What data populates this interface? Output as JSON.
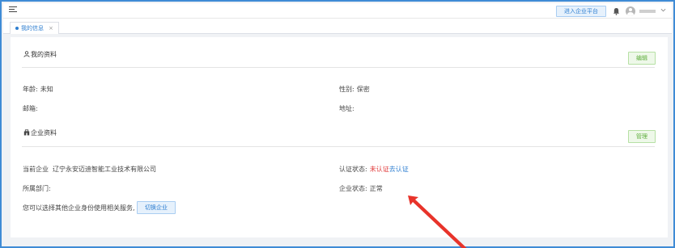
{
  "topbar": {
    "enter_enterprise_label": "进入企业平台",
    "icons": {
      "menu": "menu-toggle-icon",
      "bell": "bell-icon",
      "avatar": "user-avatar-icon",
      "chevron": "chevron-down-icon"
    }
  },
  "tabs": [
    {
      "label": "我的信息",
      "close": "×",
      "active": true
    }
  ],
  "profile": {
    "title": "我的资料",
    "edit_label": "编辑",
    "age_label": "年龄:",
    "age_value": "未知",
    "gender_label": "性别:",
    "gender_value": "保密",
    "email_label": "邮箱:",
    "email_value": "",
    "address_label": "地址:",
    "address_value": ""
  },
  "enterprise": {
    "title": "企业资料",
    "manage_label": "管理",
    "current_label": "当前企业",
    "current_value": "辽宁永安迈迪智能工业技术有限公司",
    "cert_label": "认证状态:",
    "cert_value": "未认证",
    "cert_link": "去认证",
    "dept_label": "所属部门:",
    "dept_value": "",
    "status_label": "企业状态:",
    "status_value": "正常",
    "switch_hint": "您可以选择其他企业身份使用相关服务,",
    "switch_label": "切换企业"
  },
  "colors": {
    "frame_border": "#3f8bd6",
    "primary": "#2f7fd1",
    "success": "#5fae3d",
    "danger": "#e03a3a",
    "annotation_arrow": "#e8332a"
  }
}
